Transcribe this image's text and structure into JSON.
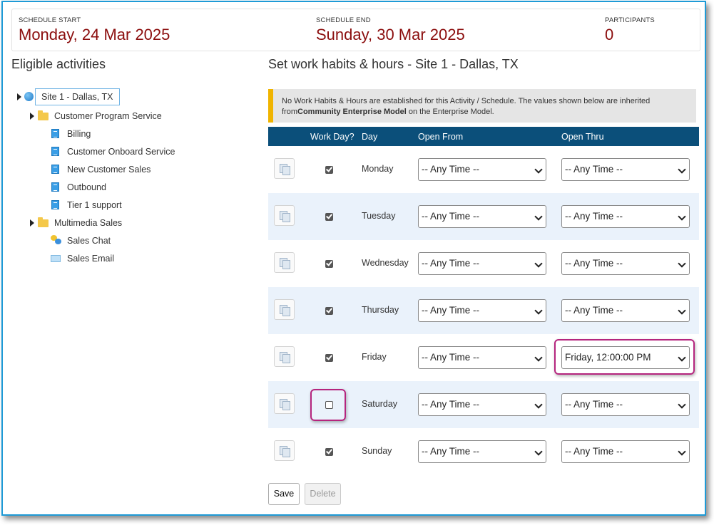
{
  "header": {
    "schedule_start_label": "SCHEDULE START",
    "schedule_start_value": "Monday, 24 Mar 2025",
    "schedule_end_label": "SCHEDULE END",
    "schedule_end_value": "Sunday, 30 Mar 2025",
    "participants_label": "PARTICIPANTS",
    "participants_value": "0"
  },
  "left": {
    "title": "Eligible activities",
    "tree": {
      "root": "Site 1 - Dallas, TX",
      "group1": "Customer Program Service",
      "group1_items": [
        "Billing",
        "Customer Onboard Service",
        "New Customer Sales",
        "Outbound",
        "Tier 1 support"
      ],
      "group2": "Multimedia Sales",
      "group2_items": [
        "Sales Chat",
        "Sales Email"
      ]
    }
  },
  "right": {
    "title": "Set work habits & hours - Site 1 - Dallas, TX",
    "notice_part1": "No Work Habits & Hours are established for this Activity / Schedule. The values shown below are inherited from",
    "notice_bold": "Community Enterprise Model",
    "notice_part2": " on the Enterprise Model.",
    "columns": [
      "Work Day?",
      "Day",
      "Open From",
      "Open Thru"
    ],
    "rows": [
      {
        "day": "Monday",
        "work_day": true,
        "open_from": "-- Any Time --",
        "open_thru": "-- Any Time --"
      },
      {
        "day": "Tuesday",
        "work_day": true,
        "open_from": "-- Any Time --",
        "open_thru": "-- Any Time --"
      },
      {
        "day": "Wednesday",
        "work_day": true,
        "open_from": "-- Any Time --",
        "open_thru": "-- Any Time --"
      },
      {
        "day": "Thursday",
        "work_day": true,
        "open_from": "-- Any Time --",
        "open_thru": "-- Any Time --"
      },
      {
        "day": "Friday",
        "work_day": true,
        "open_from": "-- Any Time --",
        "open_thru": "Friday, 12:00:00 PM"
      },
      {
        "day": "Saturday",
        "work_day": false,
        "open_from": "-- Any Time --",
        "open_thru": "-- Any Time --"
      },
      {
        "day": "Sunday",
        "work_day": true,
        "open_from": "-- Any Time --",
        "open_thru": "-- Any Time --"
      }
    ],
    "save_label": "Save",
    "delete_label": "Delete"
  },
  "colors": {
    "accent_dark_red": "#8b0d0d",
    "table_header": "#0b4f7a",
    "highlight": "#b5257e",
    "notice_bar": "#f0b400"
  }
}
